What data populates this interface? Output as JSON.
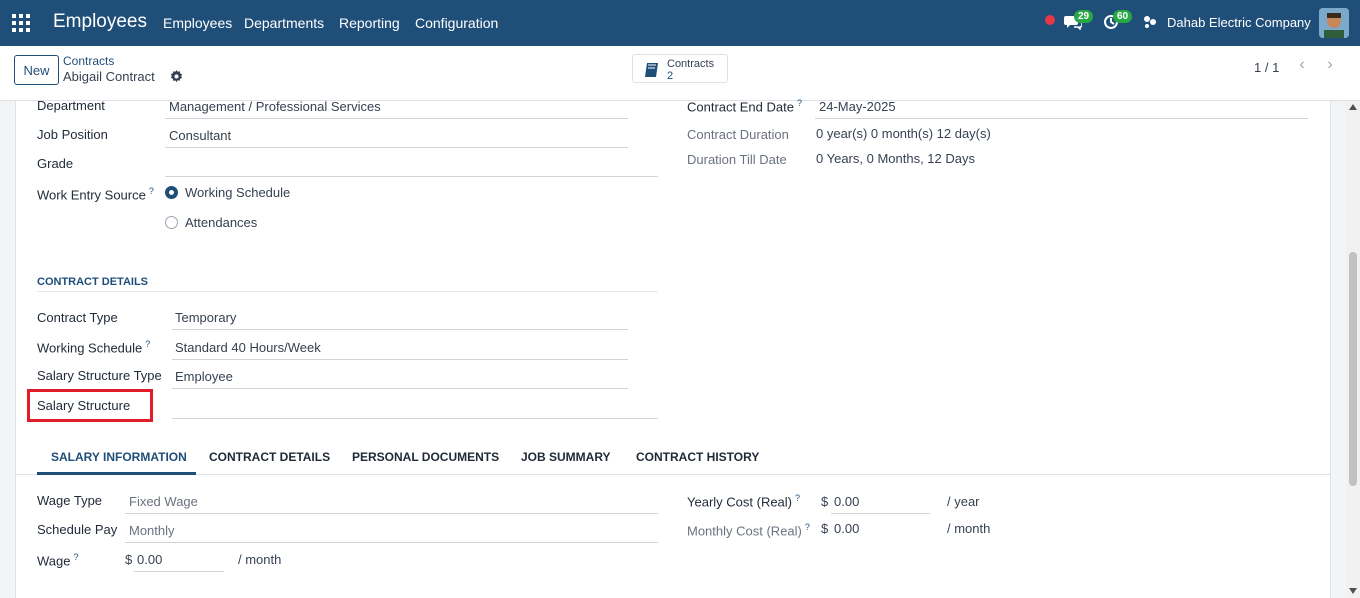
{
  "topbar": {
    "app_title": "Employees",
    "menu": [
      "Employees",
      "Departments",
      "Reporting",
      "Configuration"
    ],
    "chat_count": "29",
    "activity_count": "60",
    "company": "Dahab Electric Company"
  },
  "control_panel": {
    "new_label": "New",
    "breadcrumb_parent": "Contracts",
    "breadcrumb_current": "Abigail Contract",
    "smart_button": {
      "label": "Contracts",
      "count": "2"
    },
    "pager": "1 / 1"
  },
  "form": {
    "department": {
      "label": "Department",
      "value": "Management / Professional Services"
    },
    "job_position": {
      "label": "Job Position",
      "value": "Consultant"
    },
    "grade": {
      "label": "Grade",
      "value": ""
    },
    "work_entry_source": {
      "label": "Work Entry Source",
      "help": "?",
      "options": [
        "Working Schedule",
        "Attendances"
      ],
      "selected": "Working Schedule"
    },
    "contract_end_date": {
      "label": "Contract End Date",
      "help": "?",
      "value": "24-May-2025"
    },
    "contract_duration": {
      "label": "Contract Duration",
      "value": "0 year(s) 0 month(s) 12 day(s)"
    },
    "duration_till_date": {
      "label": "Duration Till Date",
      "value": "0 Years, 0 Months, 12 Days"
    },
    "section_contract_details": "CONTRACT DETAILS",
    "contract_type": {
      "label": "Contract Type",
      "value": "Temporary"
    },
    "working_schedule": {
      "label": "Working Schedule",
      "help": "?",
      "value": "Standard 40 Hours/Week"
    },
    "salary_structure_type": {
      "label": "Salary Structure Type",
      "value": "Employee"
    },
    "salary_structure": {
      "label": "Salary Structure",
      "value": ""
    }
  },
  "tabs": [
    "SALARY INFORMATION",
    "CONTRACT DETAILS",
    "PERSONAL DOCUMENTS",
    "JOB SUMMARY",
    "CONTRACT HISTORY"
  ],
  "active_tab": "SALARY INFORMATION",
  "salary": {
    "wage_type": {
      "label": "Wage Type",
      "value": "Fixed Wage"
    },
    "schedule_pay": {
      "label": "Schedule Pay",
      "value": "Monthly"
    },
    "wage": {
      "label": "Wage",
      "help": "?",
      "currency": "$",
      "value": "0.00",
      "unit": "/ month"
    },
    "yearly_cost": {
      "label": "Yearly Cost (Real)",
      "help": "?",
      "currency": "$",
      "value": "0.00",
      "unit": "/ year"
    },
    "monthly_cost": {
      "label": "Monthly Cost (Real)",
      "help": "?",
      "currency": "$",
      "value": "0.00",
      "unit": "/ month"
    }
  },
  "colors": {
    "brand": "#1f4e79",
    "highlight": "#e11d2a",
    "badge": "#28a745"
  }
}
